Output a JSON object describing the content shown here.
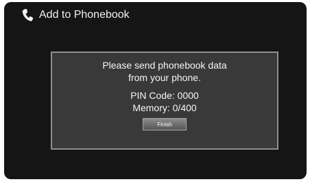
{
  "header": {
    "icon": "phone-icon",
    "title": "Add to Phonebook"
  },
  "dialog": {
    "message_line_1": "Please send phonebook data",
    "message_line_2": "from your phone.",
    "pin_code": "PIN Code: 0000",
    "memory": "Memory: 0/400",
    "finish_label": "Finish"
  },
  "colors": {
    "screen_background": "#151515",
    "dialog_background": "#393939",
    "dialog_border": "#8f8f8f",
    "text": "#f2f2f2"
  }
}
